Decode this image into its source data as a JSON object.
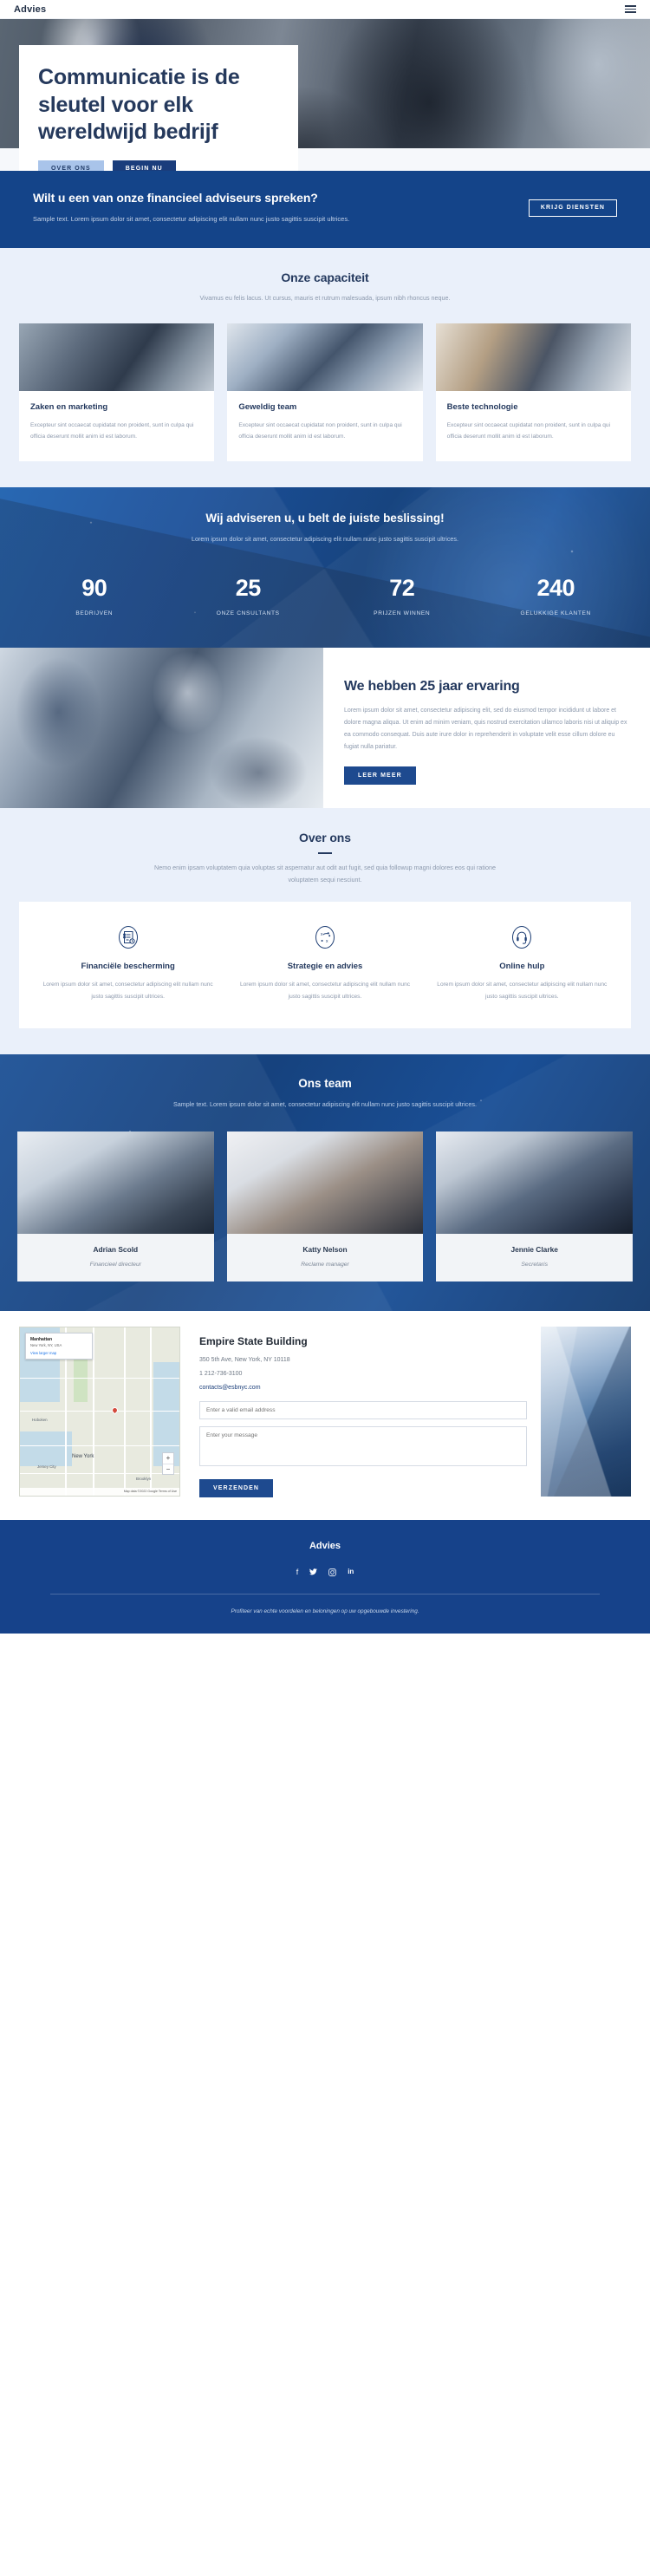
{
  "header": {
    "logo": "Advies",
    "menu_icon": "hamburger-menu-icon"
  },
  "hero": {
    "title": "Communicatie is de sleutel voor elk wereldwijd bedrijf",
    "btn_secondary": "OVER ONS",
    "btn_primary": "BEGIN NU"
  },
  "cta": {
    "heading": "Wilt u een van onze financieel adviseurs spreken?",
    "text": "Sample text. Lorem ipsum dolor sit amet, consectetur adipiscing elit nullam nunc justo sagittis suscipit ultrices.",
    "button": "KRIJG DIENSTEN"
  },
  "capacity": {
    "title": "Onze capaciteit",
    "subtitle": "Vivamus eu felis lacus. Ut cursus, mauris et rutrum malesuada, ipsum nibh rhoncus neque.",
    "cards": [
      {
        "title": "Zaken en marketing",
        "text": "Excepteur sint occaecat cupidatat non proident, sunt in culpa qui officia deserunt mollit anim id est laborum."
      },
      {
        "title": "Geweldig team",
        "text": "Excepteur sint occaecat cupidatat non proident, sunt in culpa qui officia deserunt mollit anim id est laborum."
      },
      {
        "title": "Beste technologie",
        "text": "Excepteur sint occaecat cupidatat non proident, sunt in culpa qui officia deserunt mollit anim id est laborum."
      }
    ]
  },
  "stats": {
    "heading": "Wij adviseren u, u belt de juiste beslissing!",
    "text": "Lorem ipsum dolor sit amet, consectetur adipiscing elit nullam nunc justo sagittis suscipit ultrices.",
    "items": [
      {
        "value": "90",
        "label": "BEDRIJVEN"
      },
      {
        "value": "25",
        "label": "ONZE CNSULTANTS"
      },
      {
        "value": "72",
        "label": "PRIJZEN WINNEN"
      },
      {
        "value": "240",
        "label": "GELUKKIGE KLANTEN"
      }
    ]
  },
  "experience": {
    "title": "We hebben 25 jaar ervaring",
    "text": "Lorem ipsum dolor sit amet, consectetur adipiscing elit, sed do eiusmod tempor incididunt ut labore et dolore magna aliqua. Ut enim ad minim veniam, quis nostrud exercitation ullamco laboris nisi ut aliquip ex ea commodo consequat. Duis aute irure dolor in reprehenderit in voluptate velit esse cillum dolore eu fugiat nulla pariatur.",
    "button": "LEER MEER"
  },
  "about": {
    "title": "Over ons",
    "subtitle": "Nemo enim ipsam voluptatem quia voluptas sit aspernatur aut odit aut fugit, sed quia followup magni dolores eos qui ratione voluptatem sequi nesciunt.",
    "features": [
      {
        "icon": "checklist-clipboard-icon",
        "title": "Financiële bescherming",
        "text": "Lorem ipsum dolor sit amet, consectetur adipiscing elit nullam nunc justo sagittis suscipit ultrices."
      },
      {
        "icon": "strategy-path-icon",
        "title": "Strategie en advies",
        "text": "Lorem ipsum dolor sit amet, consectetur adipiscing elit nullam nunc justo sagittis suscipit ultrices."
      },
      {
        "icon": "headset-support-icon",
        "title": "Online hulp",
        "text": "Lorem ipsum dolor sit amet, consectetur adipiscing elit nullam nunc justo sagittis suscipit ultrices."
      }
    ]
  },
  "team": {
    "title": "Ons team",
    "subtitle": "Sample text. Lorem ipsum dolor sit amet, consectetur adipiscing elit nullam nunc justo sagittis suscipit ultrices.",
    "members": [
      {
        "name": "Adrian Scold",
        "role": "Financieel directeur"
      },
      {
        "name": "Katty Nelson",
        "role": "Reclame manager"
      },
      {
        "name": "Jennie Clarke",
        "role": "Secretaris"
      }
    ]
  },
  "contact": {
    "map": {
      "card_title": "Manhattan",
      "card_subtitle": "New York, NY, USA",
      "card_link": "View larger map",
      "zoom_in": "+",
      "zoom_out": "−",
      "labels": [
        "Hoboken",
        "New York",
        "Jersey City",
        "Brooklyn"
      ],
      "credit": "Map data ©2022 Google   Terms of Use"
    },
    "title": "Empire State Building",
    "address": "350 5th Ave, New York, NY 10118",
    "phone": "1 212-736-3100",
    "email": "contacts@esbnyc.com",
    "email_placeholder": "Enter a valid email address",
    "message_placeholder": "Enter your message",
    "submit": "VERZENDEN"
  },
  "footer": {
    "brand": "Advies",
    "socials": [
      {
        "icon": "facebook-icon",
        "glyph": "f"
      },
      {
        "icon": "twitter-icon",
        "glyph": "ᴠ"
      },
      {
        "icon": "instagram-icon",
        "glyph": "□"
      },
      {
        "icon": "linkedin-icon",
        "glyph": "in"
      }
    ],
    "note": "Profiteer van echte voordelen en beloningen op uw opgebouwde investering."
  }
}
